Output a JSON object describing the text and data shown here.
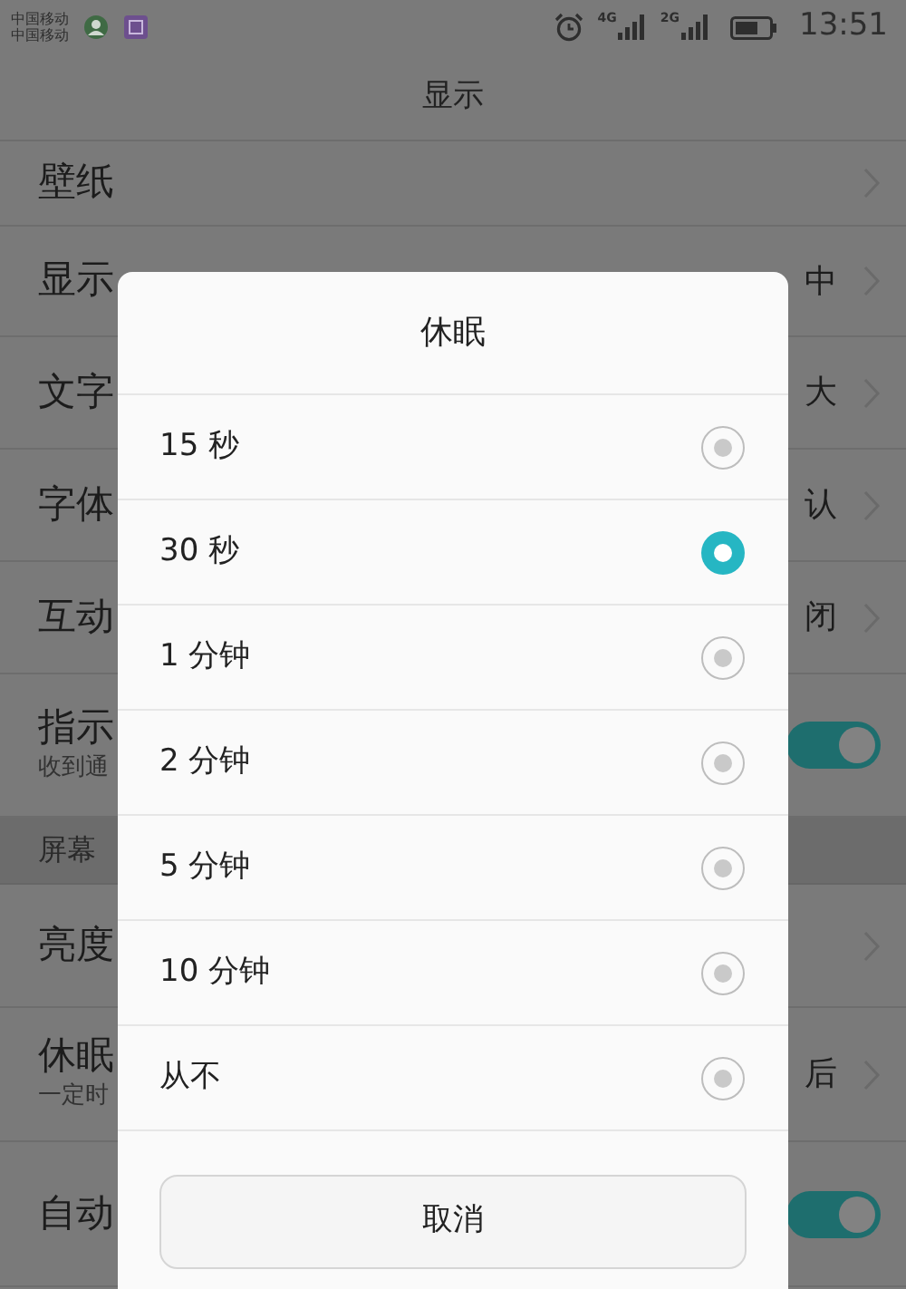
{
  "status_bar": {
    "carriers": [
      "中国移动",
      "中国移动"
    ],
    "network_labels": [
      "4G",
      "2G"
    ],
    "time": "13:51"
  },
  "header": {
    "title": "显示"
  },
  "settings": [
    {
      "kind": "item",
      "label": "壁纸"
    },
    {
      "kind": "item",
      "label": "显示",
      "value": "中"
    },
    {
      "kind": "item",
      "label": "文字",
      "value": "大"
    },
    {
      "kind": "item",
      "label": "字体",
      "value": "认"
    },
    {
      "kind": "item",
      "label": "互动",
      "value": "闭"
    },
    {
      "kind": "switch",
      "label": "指示",
      "subtitle": "收到通",
      "on": true
    },
    {
      "kind": "section",
      "label": "屏幕"
    },
    {
      "kind": "item",
      "label": "亮度"
    },
    {
      "kind": "item",
      "label": "休眠",
      "subtitle": "一定时",
      "value": "后"
    },
    {
      "kind": "switch",
      "label": "自动",
      "on": true
    }
  ],
  "dialog": {
    "title": "休眠",
    "options": [
      {
        "label": "15 秒",
        "selected": false
      },
      {
        "label": "30 秒",
        "selected": true
      },
      {
        "label": "1 分钟",
        "selected": false
      },
      {
        "label": "2 分钟",
        "selected": false
      },
      {
        "label": "5 分钟",
        "selected": false
      },
      {
        "label": "10 分钟",
        "selected": false
      },
      {
        "label": "从不",
        "selected": false
      }
    ],
    "cancel": "取消"
  }
}
